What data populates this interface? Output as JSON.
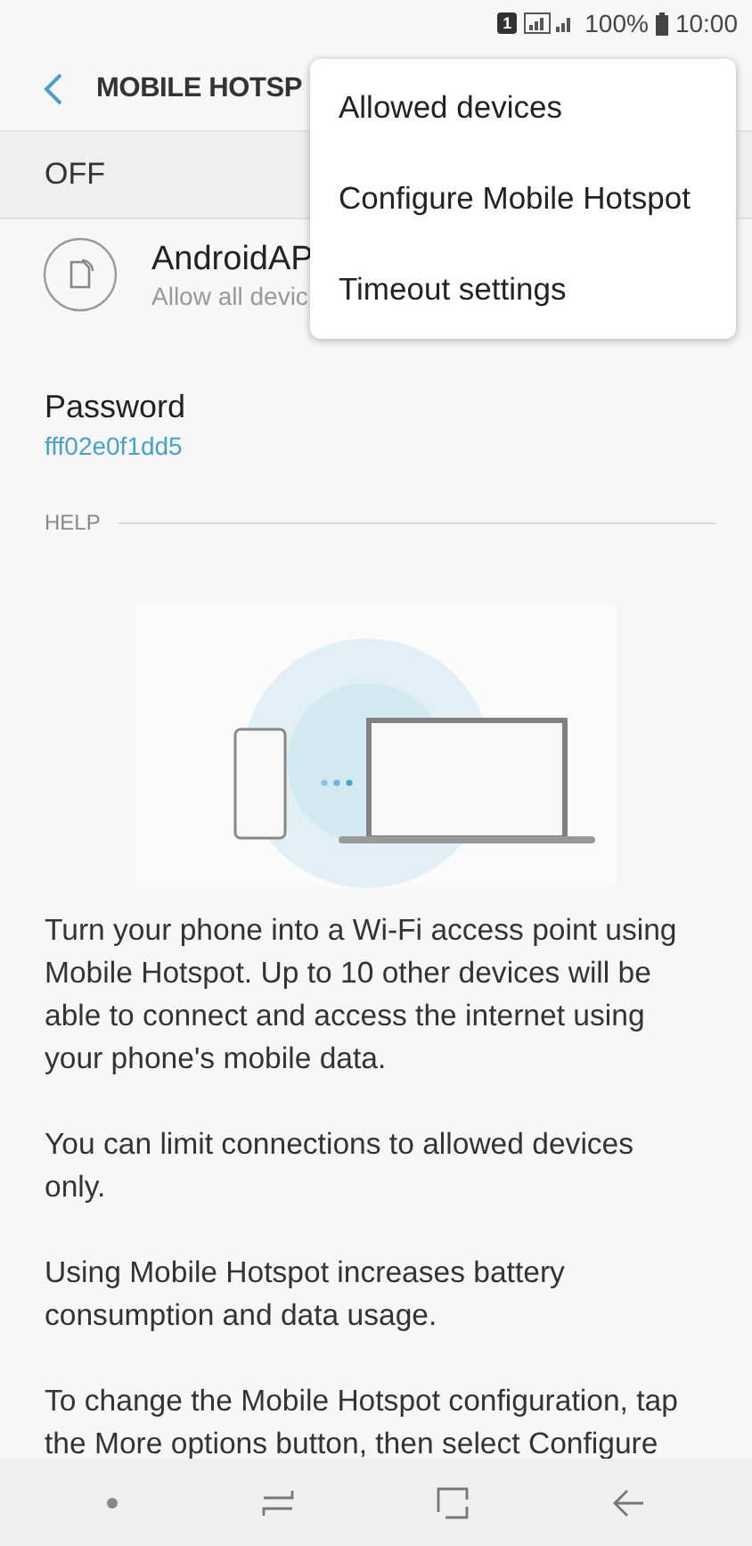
{
  "status_bar": {
    "sim": "1",
    "battery": "100%",
    "time": "10:00"
  },
  "header": {
    "title": "MOBILE HOTSP"
  },
  "switch_row": {
    "label": "OFF"
  },
  "network": {
    "name": "AndroidAP",
    "subtitle": "Allow all devic"
  },
  "password": {
    "label": "Password",
    "value": "fff02e0f1dd5"
  },
  "help": {
    "heading": "HELP",
    "paragraphs": [
      "Turn your phone into a Wi-Fi access point using Mobile Hotspot. Up to 10 other devices will be able to connect and access the internet using your phone's mobile data.",
      "You can limit connections to allowed devices only.",
      "Using Mobile Hotspot increases battery consumption and data usage.",
      "To change the Mobile Hotspot configuration, tap the More options button, then select Configure"
    ]
  },
  "menu": {
    "items": [
      "Allowed devices",
      "Configure Mobile Hotspot",
      "Timeout settings"
    ]
  }
}
